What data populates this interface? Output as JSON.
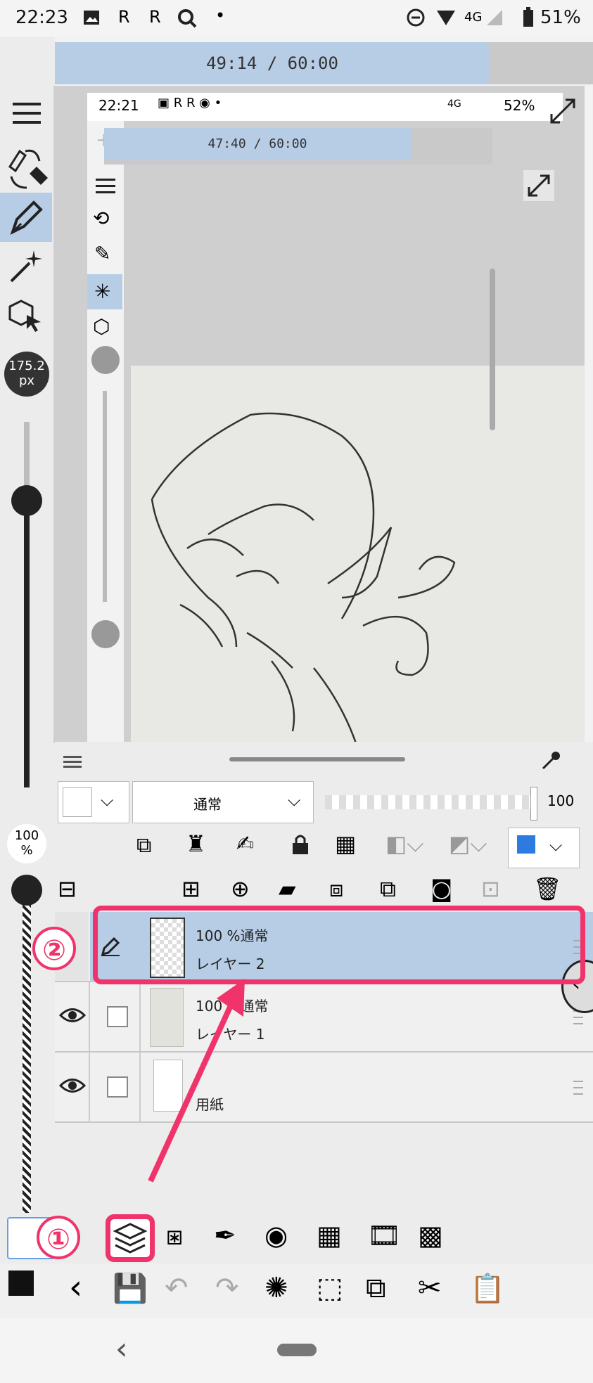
{
  "status_bar": {
    "time": "22:23",
    "network": "4G",
    "battery": "51%"
  },
  "timer": {
    "text": "49:14  /  60:00",
    "progress": 0.82
  },
  "left_toolbar": {
    "brush_size": "175.2\npx",
    "opacity": "100\n%",
    "brush_size_line1": "175.2",
    "brush_size_line2": "px",
    "opacity_line1": "100",
    "opacity_line2": "%"
  },
  "inner_screenshot": {
    "status": {
      "time": "22:21",
      "network": "4G",
      "battery": "52%"
    },
    "timer": {
      "text": "47:40  /  60:00",
      "progress": 0.79
    }
  },
  "layer_panel": {
    "blend_mode": "通常",
    "opacity_value": "100",
    "layers": [
      {
        "opacity_mode": "100 %通常",
        "name": "レイヤー 2",
        "selected": true
      },
      {
        "opacity_mode": "100 %通常",
        "name": "レイヤー 1",
        "selected": false
      },
      {
        "opacity_mode": "",
        "name": "用紙",
        "selected": false
      }
    ]
  },
  "annotations": {
    "step1": "①",
    "step2": "②",
    "color": "#f0336b"
  },
  "colors": {
    "accent": "#b7cde6",
    "selected_row": "#b7cde6",
    "annotation": "#f0336b"
  }
}
